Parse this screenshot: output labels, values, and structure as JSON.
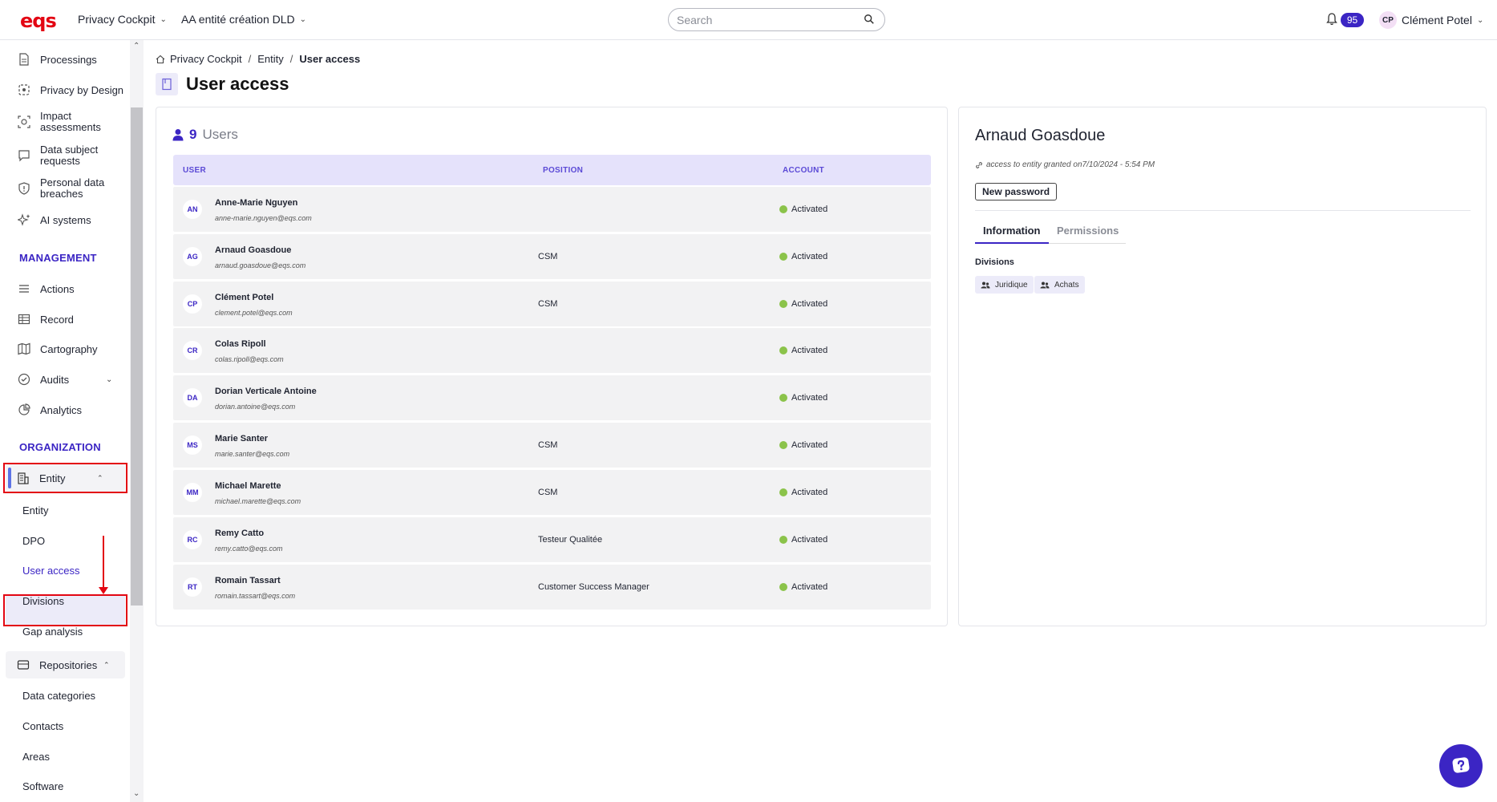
{
  "header": {
    "logo": "eqs",
    "app_select": "Privacy Cockpit",
    "entity_select": "AA entité création DLD",
    "search_placeholder": "Search",
    "notifications": "95",
    "user_initials": "CP",
    "user_name": "Clément Potel"
  },
  "sidebar": {
    "top_items": [
      {
        "label": "Processings",
        "icon": "document-icon"
      },
      {
        "label": "Privacy by Design",
        "icon": "privacy-design-icon"
      },
      {
        "label": "Impact assessments",
        "icon": "impact-icon"
      },
      {
        "label": "Data subject requests",
        "icon": "chat-icon"
      },
      {
        "label": "Personal data breaches",
        "icon": "shield-icon"
      },
      {
        "label": "AI systems",
        "icon": "sparkle-icon"
      }
    ],
    "management_title": "MANAGEMENT",
    "management_items": [
      {
        "label": "Actions",
        "icon": "list-icon"
      },
      {
        "label": "Record",
        "icon": "table-icon"
      },
      {
        "label": "Cartography",
        "icon": "map-icon"
      },
      {
        "label": "Audits",
        "icon": "check-circle-icon"
      },
      {
        "label": "Analytics",
        "icon": "pie-chart-icon"
      }
    ],
    "organization_title": "ORGANIZATION",
    "entity_group": "Entity",
    "entity_subitems": [
      "Entity",
      "DPO",
      "User access",
      "Divisions",
      "Gap analysis"
    ],
    "repositories_group": "Repositories",
    "repositories_subitems": [
      "Data categories",
      "Contacts",
      "Areas",
      "Software"
    ]
  },
  "breadcrumb": {
    "home": "Privacy Cockpit",
    "sep1": "/",
    "level1": "Entity",
    "sep2": "/",
    "current": "User access"
  },
  "page_title": "User access",
  "users_panel": {
    "count": "9",
    "label": "Users",
    "columns": [
      "USER",
      "POSITION",
      "ACCOUNT"
    ],
    "rows": [
      {
        "initials": "AN",
        "name": "Anne-Marie Nguyen",
        "email": "anne-marie.nguyen@eqs.com",
        "position": "",
        "account": "Activated"
      },
      {
        "initials": "AG",
        "name": "Arnaud Goasdoue",
        "email": "arnaud.goasdoue@eqs.com",
        "position": "CSM",
        "account": "Activated"
      },
      {
        "initials": "CP",
        "name": "Clément Potel",
        "email": "clement.potel@eqs.com",
        "position": "CSM",
        "account": "Activated"
      },
      {
        "initials": "CR",
        "name": "Colas Ripoll",
        "email": "colas.ripoll@eqs.com",
        "position": "",
        "account": "Activated"
      },
      {
        "initials": "DA",
        "name": "Dorian Verticale Antoine",
        "email": "dorian.antoine@eqs.com",
        "position": "",
        "account": "Activated"
      },
      {
        "initials": "MS",
        "name": "Marie Santer",
        "email": "marie.santer@eqs.com",
        "position": "CSM",
        "account": "Activated"
      },
      {
        "initials": "MM",
        "name": "Michael Marette",
        "email": "michael.marette@eqs.com",
        "position": "CSM",
        "account": "Activated"
      },
      {
        "initials": "RC",
        "name": "Remy Catto",
        "email": "remy.catto@eqs.com",
        "position": "Testeur Qualitée",
        "account": "Activated"
      },
      {
        "initials": "RT",
        "name": "Romain Tassart",
        "email": "romain.tassart@eqs.com",
        "position": "Customer Success Manager",
        "account": "Activated"
      }
    ]
  },
  "detail": {
    "name": "Arnaud Goasdoue",
    "granted": "access to entity granted on7/10/2024 - 5:54 PM",
    "new_password": "New password",
    "tabs": [
      "Information",
      "Permissions"
    ],
    "divisions_title": "Divisions",
    "divisions": [
      "Juridique",
      "Achats"
    ]
  },
  "colors": {
    "accent": "#3b25c4",
    "brand_red": "#e30613",
    "activated": "#8bc34a"
  }
}
